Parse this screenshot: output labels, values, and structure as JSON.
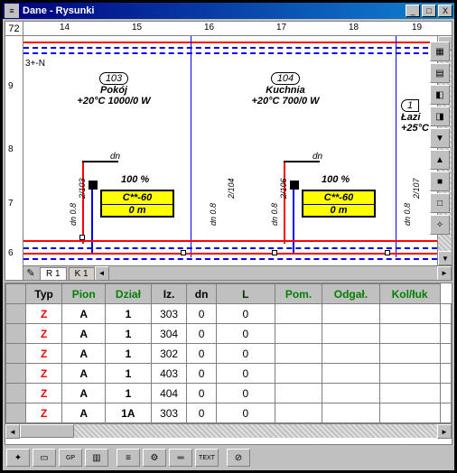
{
  "window": {
    "title": "Dane - Rysunki",
    "buttons": {
      "min": "_",
      "max": "□",
      "close": "X"
    },
    "corner_icon": "R"
  },
  "ruler": {
    "corner": "72",
    "h_ticks": [
      "14",
      "15",
      "16",
      "17",
      "18",
      "19"
    ],
    "v_ticks": [
      "9",
      "8",
      "7",
      "6"
    ]
  },
  "sheet_tabs": [
    "R 1",
    "K 1"
  ],
  "rooms": [
    {
      "id": "103",
      "name": "Pokój",
      "temp": "+20°C 1000/0 W"
    },
    {
      "id": "104",
      "name": "Kuchnia",
      "temp": "+20°C 700/0 W"
    },
    {
      "id_partial": "1",
      "name": "Łazi",
      "temp": "+25°C "
    }
  ],
  "radiators": [
    {
      "pct": "100 %",
      "model": "C**-60",
      "len": "0 m"
    },
    {
      "pct": "100 %",
      "model": "C**-60",
      "len": "0 m"
    }
  ],
  "labels": {
    "threeplusn": "3+-N",
    "dn": "dn",
    "dn0b": "dn 0.8",
    "r2_103": "2/103",
    "r2_106": "2/106",
    "r2_104": "2/104",
    "r2_107": "2/107"
  },
  "table": {
    "headers": [
      "Typ",
      "Pion",
      "Dział",
      "Iz.",
      "dn",
      "L",
      "Pom.",
      "Odgał.",
      "Kol/łuk"
    ],
    "rows": [
      [
        "Z",
        "A",
        "1",
        "303",
        "0",
        "0",
        "",
        "",
        "",
        ""
      ],
      [
        "Z",
        "A",
        "1",
        "304",
        "0",
        "0",
        "",
        "",
        "",
        ""
      ],
      [
        "Z",
        "A",
        "1",
        "302",
        "0",
        "0",
        "",
        "",
        "",
        ""
      ],
      [
        "Z",
        "A",
        "1",
        "403",
        "0",
        "0",
        "",
        "",
        "",
        ""
      ],
      [
        "Z",
        "A",
        "1",
        "404",
        "0",
        "0",
        "",
        "",
        "",
        ""
      ],
      [
        "Z",
        "A",
        "1A",
        "303",
        "0",
        "0",
        "",
        "",
        "",
        ""
      ]
    ]
  }
}
